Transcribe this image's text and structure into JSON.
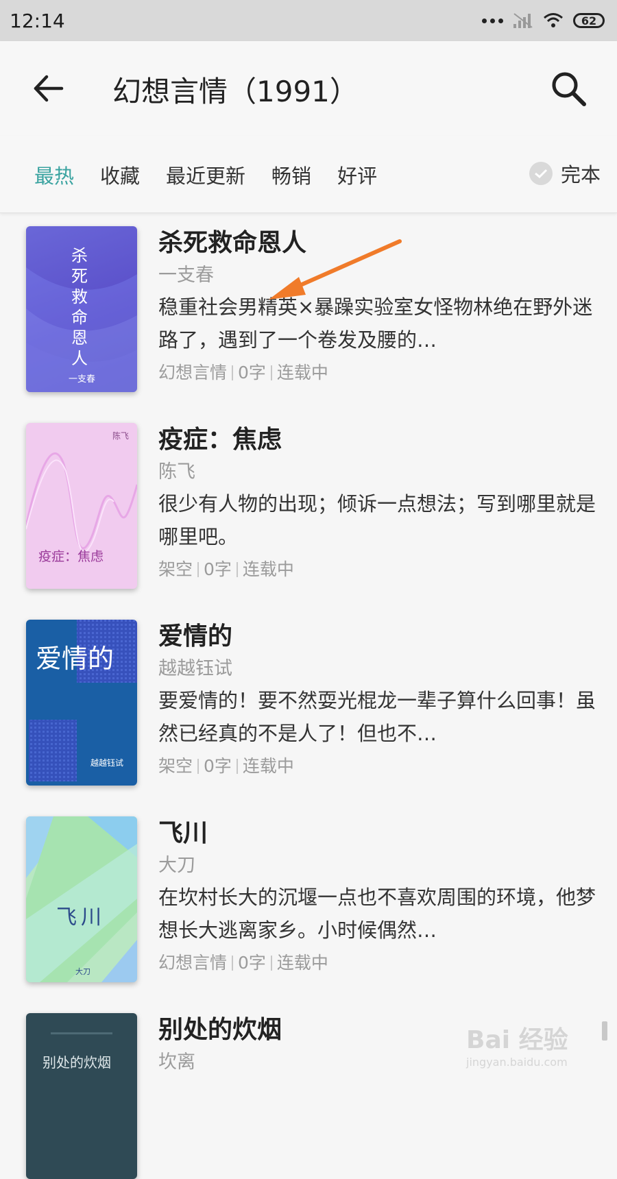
{
  "status": {
    "time": "12:14",
    "battery": "62"
  },
  "header": {
    "title": "幻想言情（1991）"
  },
  "filters": {
    "tabs": [
      "最热",
      "收藏",
      "最近更新",
      "畅销",
      "好评"
    ],
    "complete_label": "完本"
  },
  "books": [
    {
      "title": "杀死救命恩人",
      "author": "一支春",
      "desc": "稳重社会男精英×暴躁实验室女怪物林绝在野外迷路了，遇到了一个卷发及腰的…",
      "category": "幻想言情",
      "words": "0字",
      "state": "连载中",
      "cover_title": "杀死救命恩人",
      "cover_author": "一支春"
    },
    {
      "title": "疫症：焦虑",
      "author": "陈飞",
      "desc": "很少有人物的出现；倾诉一点想法；写到哪里就是哪里吧。",
      "category": "架空",
      "words": "0字",
      "state": "连载中",
      "cover_title": "疫症：焦虑",
      "cover_author": "陈飞"
    },
    {
      "title": "爱情的",
      "author": "越越钰试",
      "desc": "要爱情的！要不然耍光棍龙一辈子算什么回事！虽然已经真的不是人了！但也不…",
      "category": "架空",
      "words": "0字",
      "state": "连载中",
      "cover_title": "爱情的",
      "cover_author": "越越钰试"
    },
    {
      "title": "飞川",
      "author": "大刀",
      "desc": "在坎村长大的沉堰一点也不喜欢周围的环境，他梦想长大逃离家乡。小时候偶然…",
      "category": "幻想言情",
      "words": "0字",
      "state": "连载中",
      "cover_title": "飞川",
      "cover_author": "大刀"
    },
    {
      "title": "别处的炊烟",
      "author": "坎离",
      "cover_title": "别处的炊烟"
    }
  ],
  "watermark": {
    "main": "Bai 经验",
    "sub": "jingyan.baidu.com"
  }
}
